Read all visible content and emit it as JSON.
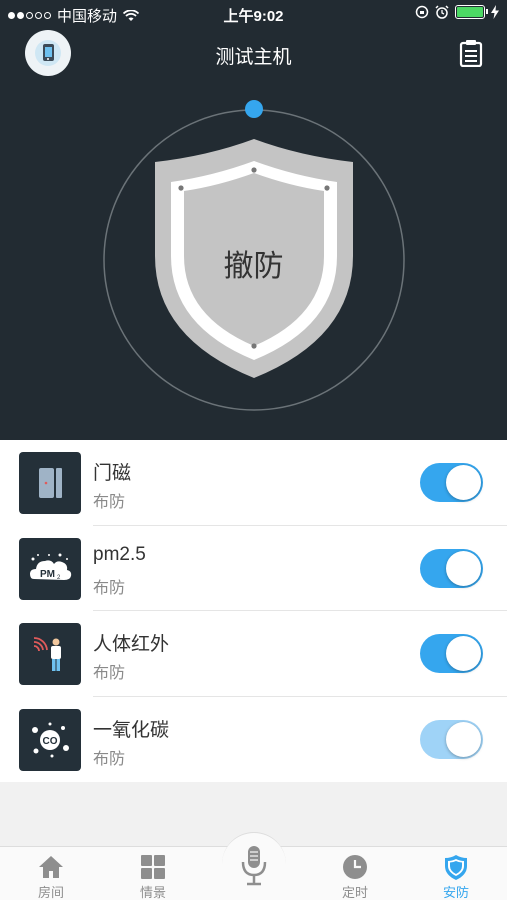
{
  "status_bar": {
    "carrier": "中国移动",
    "time": "上午9:02"
  },
  "header": {
    "title": "测试主机",
    "arm_state": "撤防"
  },
  "devices": [
    {
      "name": "门磁",
      "status": "布防",
      "icon": "door-sensor-icon",
      "enabled": true
    },
    {
      "name": "pm2.5",
      "status": "布防",
      "icon": "pm25-icon",
      "icon_text": "PM",
      "icon_sub": "2",
      "enabled": true
    },
    {
      "name": "人体红外",
      "status": "布防",
      "icon": "infrared-human-icon",
      "enabled": true
    },
    {
      "name": "一氧化碳",
      "status": "布防",
      "icon": "co-sensor-icon",
      "icon_text": "CO",
      "enabled": true
    }
  ],
  "tabs": [
    {
      "label": "房间",
      "icon": "home-icon"
    },
    {
      "label": "情景",
      "icon": "grid-icon"
    },
    {
      "label": "定时",
      "icon": "clock-icon"
    },
    {
      "label": "安防",
      "icon": "shield-icon",
      "active": true
    }
  ],
  "colors": {
    "accent": "#35a6ee",
    "header_bg": "#222b32"
  }
}
